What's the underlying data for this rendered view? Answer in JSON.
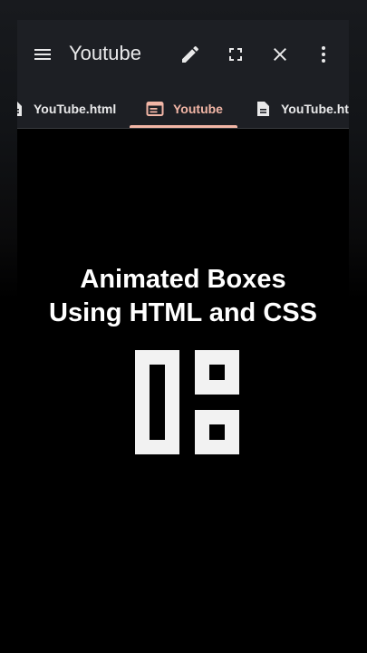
{
  "toolbar": {
    "title": "Youtube",
    "icons": {
      "menu": "menu-icon",
      "edit": "pencil-icon",
      "fullscreen": "fullscreen-icon",
      "close": "close-icon",
      "more": "more-vert-icon"
    }
  },
  "tabs": [
    {
      "label": "YouTube.html",
      "icon": "file-icon",
      "active": false
    },
    {
      "label": "Youtube",
      "icon": "browser-preview-icon",
      "active": true
    },
    {
      "label": "YouTube.html",
      "icon": "file-icon",
      "active": false
    }
  ],
  "content": {
    "heading_line1": "Animated Boxes",
    "heading_line2": "Using HTML and CSS"
  },
  "colors": {
    "toolbar_bg": "#1d1f24",
    "accent": "#f2b6a6",
    "content_bg": "#000000",
    "text": "#ffffff"
  }
}
